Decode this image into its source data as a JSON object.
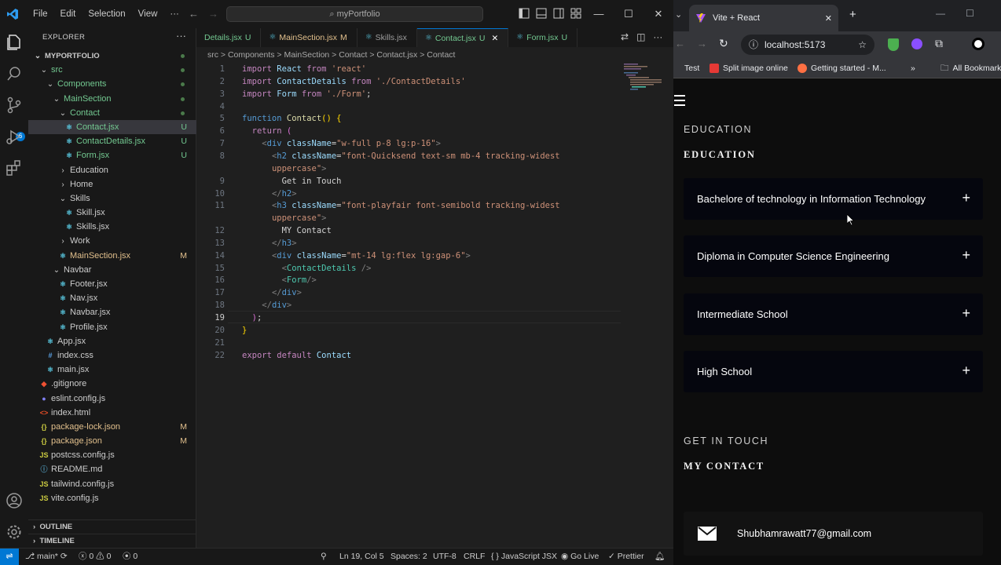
{
  "vscode": {
    "menu": [
      "File",
      "Edit",
      "Selection",
      "View",
      "···"
    ],
    "command_center": "myPortfolio",
    "explorer_title": "EXPLORER",
    "tree": [
      {
        "label": "MYPORTFOLIO",
        "indent": 0,
        "chev": "down",
        "root": true,
        "dot": true
      },
      {
        "label": "src",
        "indent": 1,
        "chev": "down",
        "color": "green",
        "dot": true
      },
      {
        "label": "Components",
        "indent": 2,
        "chev": "down",
        "color": "green",
        "dot": true
      },
      {
        "label": "MainSection",
        "indent": 3,
        "chev": "down",
        "color": "green",
        "dot": true
      },
      {
        "label": "Contact",
        "indent": 4,
        "chev": "down",
        "color": "green",
        "dot": true
      },
      {
        "label": "Contact.jsx",
        "indent": 5,
        "icon": "react",
        "color": "green",
        "status": "U",
        "selected": true
      },
      {
        "label": "ContactDetails.jsx",
        "indent": 5,
        "icon": "react",
        "color": "green",
        "status": "U"
      },
      {
        "label": "Form.jsx",
        "indent": 5,
        "icon": "react",
        "color": "green",
        "status": "U"
      },
      {
        "label": "Education",
        "indent": 4,
        "chev": "right"
      },
      {
        "label": "Home",
        "indent": 4,
        "chev": "right"
      },
      {
        "label": "Skills",
        "indent": 4,
        "chev": "down"
      },
      {
        "label": "Skill.jsx",
        "indent": 5,
        "icon": "react"
      },
      {
        "label": "Skills.jsx",
        "indent": 5,
        "icon": "react"
      },
      {
        "label": "Work",
        "indent": 4,
        "chev": "right"
      },
      {
        "label": "MainSection.jsx",
        "indent": 4,
        "icon": "react",
        "color": "yellow",
        "status": "M"
      },
      {
        "label": "Navbar",
        "indent": 3,
        "chev": "down"
      },
      {
        "label": "Footer.jsx",
        "indent": 4,
        "icon": "react"
      },
      {
        "label": "Nav.jsx",
        "indent": 4,
        "icon": "react"
      },
      {
        "label": "Navbar.jsx",
        "indent": 4,
        "icon": "react"
      },
      {
        "label": "Profile.jsx",
        "indent": 4,
        "icon": "react"
      },
      {
        "label": "App.jsx",
        "indent": 2,
        "icon": "react"
      },
      {
        "label": "index.css",
        "indent": 2,
        "icon": "css"
      },
      {
        "label": "main.jsx",
        "indent": 2,
        "icon": "react"
      },
      {
        "label": ".gitignore",
        "indent": 1,
        "icon": "git"
      },
      {
        "label": "eslint.config.js",
        "indent": 1,
        "icon": "eslint"
      },
      {
        "label": "index.html",
        "indent": 1,
        "icon": "html"
      },
      {
        "label": "package-lock.json",
        "indent": 1,
        "icon": "json",
        "color": "yellow",
        "status": "M"
      },
      {
        "label": "package.json",
        "indent": 1,
        "icon": "json",
        "color": "yellow",
        "status": "M"
      },
      {
        "label": "postcss.config.js",
        "indent": 1,
        "icon": "js"
      },
      {
        "label": "README.md",
        "indent": 1,
        "icon": "info"
      },
      {
        "label": "tailwind.config.js",
        "indent": 1,
        "icon": "js"
      },
      {
        "label": "vite.config.js",
        "indent": 1,
        "icon": "js"
      }
    ],
    "outline_label": "OUTLINE",
    "timeline_label": "TIMELINE",
    "tabs": [
      {
        "label": "Details.jsx",
        "status": "U"
      },
      {
        "label": "MainSection.jsx",
        "status": "M"
      },
      {
        "label": "Skills.jsx",
        "status": ""
      },
      {
        "label": "Contact.jsx",
        "status": "U",
        "active": true
      },
      {
        "label": "Form.jsx",
        "status": "U"
      }
    ],
    "breadcrumb": "src > Components > MainSection > Contact > Contact.jsx > Contact",
    "code_lines": [
      {
        "n": "1",
        "html": "<span class='kp'>import</span> <span class='v'>React</span> <span class='kp'>from</span> <span class='s'>'react'</span>"
      },
      {
        "n": "2",
        "html": "<span class='kp'>import</span> <span class='v'>ContactDetails</span> <span class='kp'>from</span> <span class='s'>'./ContactDetails'</span>"
      },
      {
        "n": "3",
        "html": "<span class='kp'>import</span> <span class='v'>Form</span> <span class='kp'>from</span> <span class='s'>'./Form'</span><span class='p'>;</span>"
      },
      {
        "n": "4",
        "html": ""
      },
      {
        "n": "5",
        "html": "<span class='k'>function</span> <span class='f'>Contact</span><span class='br'>()</span> <span class='br'>{</span>"
      },
      {
        "n": "6",
        "html": "  <span class='kp'>return</span> <span class='br2'>(</span>"
      },
      {
        "n": "7",
        "html": "    <span class='g'>&lt;</span><span class='k'>div</span> <span class='v'>className</span><span class='p'>=</span><span class='s'>\"w-full p-8 lg:p-16\"</span><span class='g'>&gt;</span>"
      },
      {
        "n": "8",
        "html": "      <span class='g'>&lt;</span><span class='k'>h2</span> <span class='v'>className</span><span class='p'>=</span><span class='s'>\"font-Quicksend text-sm mb-4 tracking-widest</span>"
      },
      {
        "n": "",
        "html": "      <span class='s'>uppercase\"</span><span class='g'>&gt;</span>"
      },
      {
        "n": "9",
        "html": "        <span class='p'>Get in Touch</span>"
      },
      {
        "n": "10",
        "html": "      <span class='g'>&lt;/</span><span class='k'>h2</span><span class='g'>&gt;</span>"
      },
      {
        "n": "11",
        "html": "      <span class='g'>&lt;</span><span class='k'>h3</span> <span class='v'>className</span><span class='p'>=</span><span class='s'>\"font-playfair font-semibold tracking-widest</span>"
      },
      {
        "n": "",
        "html": "      <span class='s'>uppercase\"</span><span class='g'>&gt;</span>"
      },
      {
        "n": "12",
        "html": "        <span class='p'>MY Contact</span>"
      },
      {
        "n": "13",
        "html": "      <span class='g'>&lt;/</span><span class='k'>h3</span><span class='g'>&gt;</span>"
      },
      {
        "n": "14",
        "html": "      <span class='g'>&lt;</span><span class='k'>div</span> <span class='v'>className</span><span class='p'>=</span><span class='s'>\"mt-14 lg:flex lg:gap-6\"</span><span class='g'>&gt;</span>"
      },
      {
        "n": "15",
        "html": "        <span class='g'>&lt;</span><span class='t'>ContactDetails</span> <span class='g'>/&gt;</span>"
      },
      {
        "n": "16",
        "html": "        <span class='g'>&lt;</span><span class='t'>Form</span><span class='g'>/&gt;</span>"
      },
      {
        "n": "17",
        "html": "      <span class='g'>&lt;/</span><span class='k'>div</span><span class='g'>&gt;</span>"
      },
      {
        "n": "18",
        "html": "    <span class='g'>&lt;/</span><span class='k'>div</span><span class='g'>&gt;</span>"
      },
      {
        "n": "19",
        "html": "  <span class='br2'>)</span><span class='p'>;</span>",
        "current": true
      },
      {
        "n": "20",
        "html": "<span class='br'>}</span>"
      },
      {
        "n": "21",
        "html": ""
      },
      {
        "n": "22",
        "html": "<span class='kp'>export</span> <span class='kp'>default</span> <span class='v'>Contact</span>"
      }
    ],
    "status": {
      "branch": "main*",
      "errors": "0",
      "warnings": "0",
      "ports": "0",
      "position": "Ln 19, Col 5",
      "spaces": "Spaces: 2",
      "encoding": "UTF-8",
      "eol": "CRLF",
      "language": "JavaScript JSX",
      "golive": "Go Live",
      "prettier": "Prettier"
    }
  },
  "chrome": {
    "tab_title": "Vite + React",
    "url": "localhost:5173",
    "bookmarks": [
      "Test",
      "Split image online",
      "Getting started - M...",
      "All Bookmarks"
    ]
  },
  "site": {
    "education_sub": "EDUCATION",
    "education_title": "EDUCATION",
    "education_items": [
      "Bachelore of technology in Information Technology",
      "Diploma in Computer Science Engineering",
      "Intermediate School",
      "High School"
    ],
    "contact_sub": "GET IN TOUCH",
    "contact_title": "MY CONTACT",
    "email": "Shubhamrawatt77@gmail.com"
  },
  "colors": {
    "vscode_bg": "#1f1f1f",
    "vscode_accent": "#0078d4",
    "untracked_green": "#73c991",
    "modified_yellow": "#e2c08d",
    "site_bg": "#0d0d0d",
    "card_bg": "#05060e"
  }
}
